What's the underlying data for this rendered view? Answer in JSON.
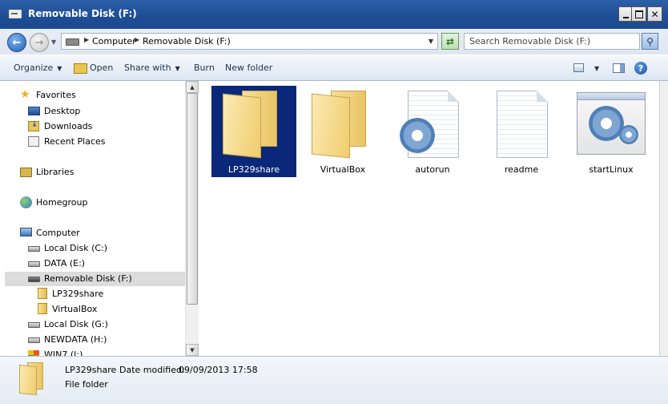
{
  "window": {
    "title": "Removable Disk (F:)"
  },
  "address": {
    "crumbs": [
      "Computer",
      "Removable Disk (F:)"
    ],
    "search_placeholder": "Search Removable Disk (F:)"
  },
  "toolbar": {
    "organize": "Organize",
    "open": "Open",
    "share_with": "Share with",
    "burn": "Burn",
    "new_folder": "New folder"
  },
  "nav": {
    "favorites": "Favorites",
    "desktop": "Desktop",
    "downloads": "Downloads",
    "recent_places": "Recent Places",
    "libraries": "Libraries",
    "homegroup": "Homegroup",
    "computer": "Computer",
    "local_c": "Local Disk (C:)",
    "data_e": "DATA (E:)",
    "removable_f": "Removable Disk (F:)",
    "lp329share": "LP329share",
    "virtualbox": "VirtualBox",
    "local_g": "Local Disk (G:)",
    "newdata_h": "NEWDATA (H:)",
    "win7_i": "WIN7 (I:)"
  },
  "files": [
    {
      "name": "LP329share",
      "type": "folder",
      "selected": true
    },
    {
      "name": "VirtualBox",
      "type": "folder",
      "selected": false
    },
    {
      "name": "autorun",
      "type": "settings-file",
      "selected": false
    },
    {
      "name": "readme",
      "type": "text-file",
      "selected": false
    },
    {
      "name": "startLinux",
      "type": "application",
      "selected": false
    }
  ],
  "details": {
    "name": "LP329share",
    "modified_label": "Date modified:",
    "modified_value": "09/09/2013 17:58",
    "type": "File folder"
  },
  "colors": {
    "titlebar": "#1f4d94",
    "selection": "#0b2779",
    "nav_selected": "#dcdcdc"
  }
}
